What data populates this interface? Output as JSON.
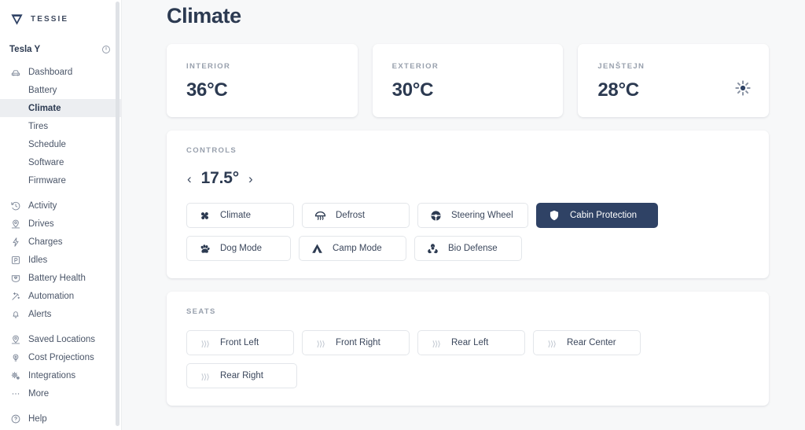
{
  "sidebar": {
    "brand": "TESSIE",
    "vehicle": {
      "name": "Tesla Y",
      "icon": "power-icon"
    },
    "items": [
      {
        "label": "Dashboard",
        "icon": "car-icon",
        "active": false,
        "sub": false
      },
      {
        "label": "Battery",
        "icon": "",
        "active": false,
        "sub": true
      },
      {
        "label": "Climate",
        "icon": "",
        "active": true,
        "sub": true
      },
      {
        "label": "Tires",
        "icon": "",
        "active": false,
        "sub": true
      },
      {
        "label": "Schedule",
        "icon": "",
        "active": false,
        "sub": true
      },
      {
        "label": "Software",
        "icon": "",
        "active": false,
        "sub": true
      },
      {
        "label": "Firmware",
        "icon": "",
        "active": false,
        "sub": true
      },
      {
        "label": "Activity",
        "icon": "history-icon",
        "active": false,
        "sub": false
      },
      {
        "label": "Drives",
        "icon": "route-icon",
        "active": false,
        "sub": false
      },
      {
        "label": "Charges",
        "icon": "bolt-icon",
        "active": false,
        "sub": false
      },
      {
        "label": "Idles",
        "icon": "parking-icon",
        "active": false,
        "sub": false
      },
      {
        "label": "Battery Health",
        "icon": "battery-heart-icon",
        "active": false,
        "sub": false
      },
      {
        "label": "Automation",
        "icon": "magic-wand-icon",
        "active": false,
        "sub": false
      },
      {
        "label": "Alerts",
        "icon": "bell-icon",
        "active": false,
        "sub": false
      },
      {
        "label": "Saved Locations",
        "icon": "map-pin-icon",
        "active": false,
        "sub": false
      },
      {
        "label": "Cost Projections",
        "icon": "lightbulb-icon",
        "active": false,
        "sub": false
      },
      {
        "label": "Integrations",
        "icon": "gears-icon",
        "active": false,
        "sub": false
      },
      {
        "label": "More",
        "icon": "ellipsis-icon",
        "active": false,
        "sub": false
      },
      {
        "label": "Help",
        "icon": "question-circle-icon",
        "active": false,
        "sub": false
      }
    ],
    "group_breaks": [
      6,
      13,
      17
    ]
  },
  "main": {
    "title": "Climate",
    "stats": [
      {
        "label": "INTERIOR",
        "value": "36°C",
        "icon": ""
      },
      {
        "label": "EXTERIOR",
        "value": "30°C",
        "icon": ""
      },
      {
        "label": "JENŠTEJN",
        "value": "28°C",
        "icon": "sun-icon"
      }
    ],
    "controls": {
      "label": "CONTROLS",
      "stepper": {
        "decrement": "‹",
        "value": "17.5°",
        "increment": "›"
      },
      "buttons": [
        {
          "label": "Climate",
          "icon": "fan-icon",
          "active": false
        },
        {
          "label": "Defrost",
          "icon": "defrost-icon",
          "active": false
        },
        {
          "label": "Steering Wheel",
          "icon": "steering-icon",
          "active": false
        },
        {
          "label": "Cabin Protection",
          "icon": "shield-icon",
          "active": true
        },
        {
          "label": "Dog Mode",
          "icon": "paw-icon",
          "active": false
        },
        {
          "label": "Camp Mode",
          "icon": "tent-icon",
          "active": false
        },
        {
          "label": "Bio Defense",
          "icon": "biohazard-icon",
          "active": false
        }
      ]
    },
    "seats": {
      "label": "SEATS",
      "buttons": [
        {
          "label": "Front Left",
          "icon": "heat-wave-icon"
        },
        {
          "label": "Front Right",
          "icon": "heat-wave-icon"
        },
        {
          "label": "Rear Left",
          "icon": "heat-wave-icon"
        },
        {
          "label": "Rear Center",
          "icon": "heat-wave-icon"
        },
        {
          "label": "Rear Right",
          "icon": "heat-wave-icon"
        }
      ]
    }
  },
  "colors": {
    "accent": "#2f4265",
    "page_bg": "#f7f8f9",
    "card_bg": "#ffffff",
    "text": "#2c3a51",
    "muted": "#98a0ad"
  }
}
